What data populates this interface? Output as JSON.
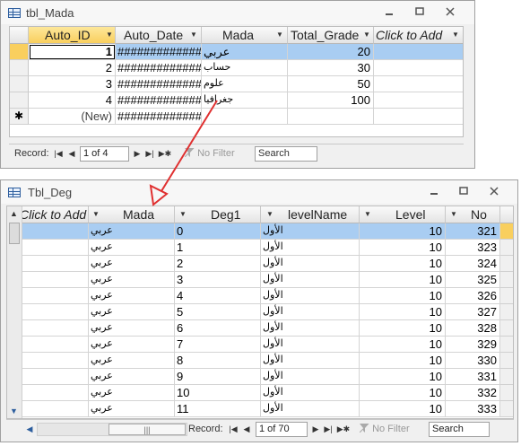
{
  "top_window": {
    "title": "tbl_Mada",
    "columns": [
      "Auto_ID",
      "Auto_Date",
      "Mada",
      "Total_Grade",
      "Click to Add"
    ],
    "rows": [
      {
        "auto_id": "1",
        "auto_date": "#############",
        "mada": "عربي",
        "total": "20"
      },
      {
        "auto_id": "2",
        "auto_date": "#############",
        "mada": "حساب",
        "total": "30"
      },
      {
        "auto_id": "3",
        "auto_date": "#############",
        "mada": "علوم",
        "total": "50"
      },
      {
        "auto_id": "4",
        "auto_date": "#############",
        "mada": "جغرافيا",
        "total": "100"
      }
    ],
    "new_row": {
      "marker": "✱",
      "auto_id": "(New)",
      "auto_date": "#############"
    },
    "nav": {
      "label": "Record:",
      "position": "1 of 4",
      "filter": "No Filter",
      "search": "Search"
    }
  },
  "bottom_window": {
    "title": "Tbl_Deg",
    "columns": [
      "Click to Add",
      "Mada",
      "Deg1",
      "levelName",
      "Level",
      "No"
    ],
    "rows": [
      {
        "mada": "عربي",
        "deg1": "0",
        "level_name": "الأول",
        "level": "10",
        "no": "321"
      },
      {
        "mada": "عربي",
        "deg1": "1",
        "level_name": "الأول",
        "level": "10",
        "no": "323"
      },
      {
        "mada": "عربي",
        "deg1": "2",
        "level_name": "الأول",
        "level": "10",
        "no": "324"
      },
      {
        "mada": "عربي",
        "deg1": "3",
        "level_name": "الأول",
        "level": "10",
        "no": "325"
      },
      {
        "mada": "عربي",
        "deg1": "4",
        "level_name": "الأول",
        "level": "10",
        "no": "326"
      },
      {
        "mada": "عربي",
        "deg1": "5",
        "level_name": "الأول",
        "level": "10",
        "no": "327"
      },
      {
        "mada": "عربي",
        "deg1": "6",
        "level_name": "الأول",
        "level": "10",
        "no": "328"
      },
      {
        "mada": "عربي",
        "deg1": "7",
        "level_name": "الأول",
        "level": "10",
        "no": "329"
      },
      {
        "mada": "عربي",
        "deg1": "8",
        "level_name": "الأول",
        "level": "10",
        "no": "330"
      },
      {
        "mada": "عربي",
        "deg1": "9",
        "level_name": "الأول",
        "level": "10",
        "no": "331"
      },
      {
        "mada": "عربي",
        "deg1": "10",
        "level_name": "الأول",
        "level": "10",
        "no": "332"
      },
      {
        "mada": "عربي",
        "deg1": "11",
        "level_name": "الأول",
        "level": "10",
        "no": "333"
      }
    ],
    "nav": {
      "label": "Record:",
      "position": "1 of 70",
      "filter": "No Filter",
      "search": "Search"
    },
    "hscroll_grip": "|||"
  },
  "annotation_arrow_color": "#e03030",
  "selection_color": "#a9cdf2",
  "header_selected_color": "#f9cf5e"
}
